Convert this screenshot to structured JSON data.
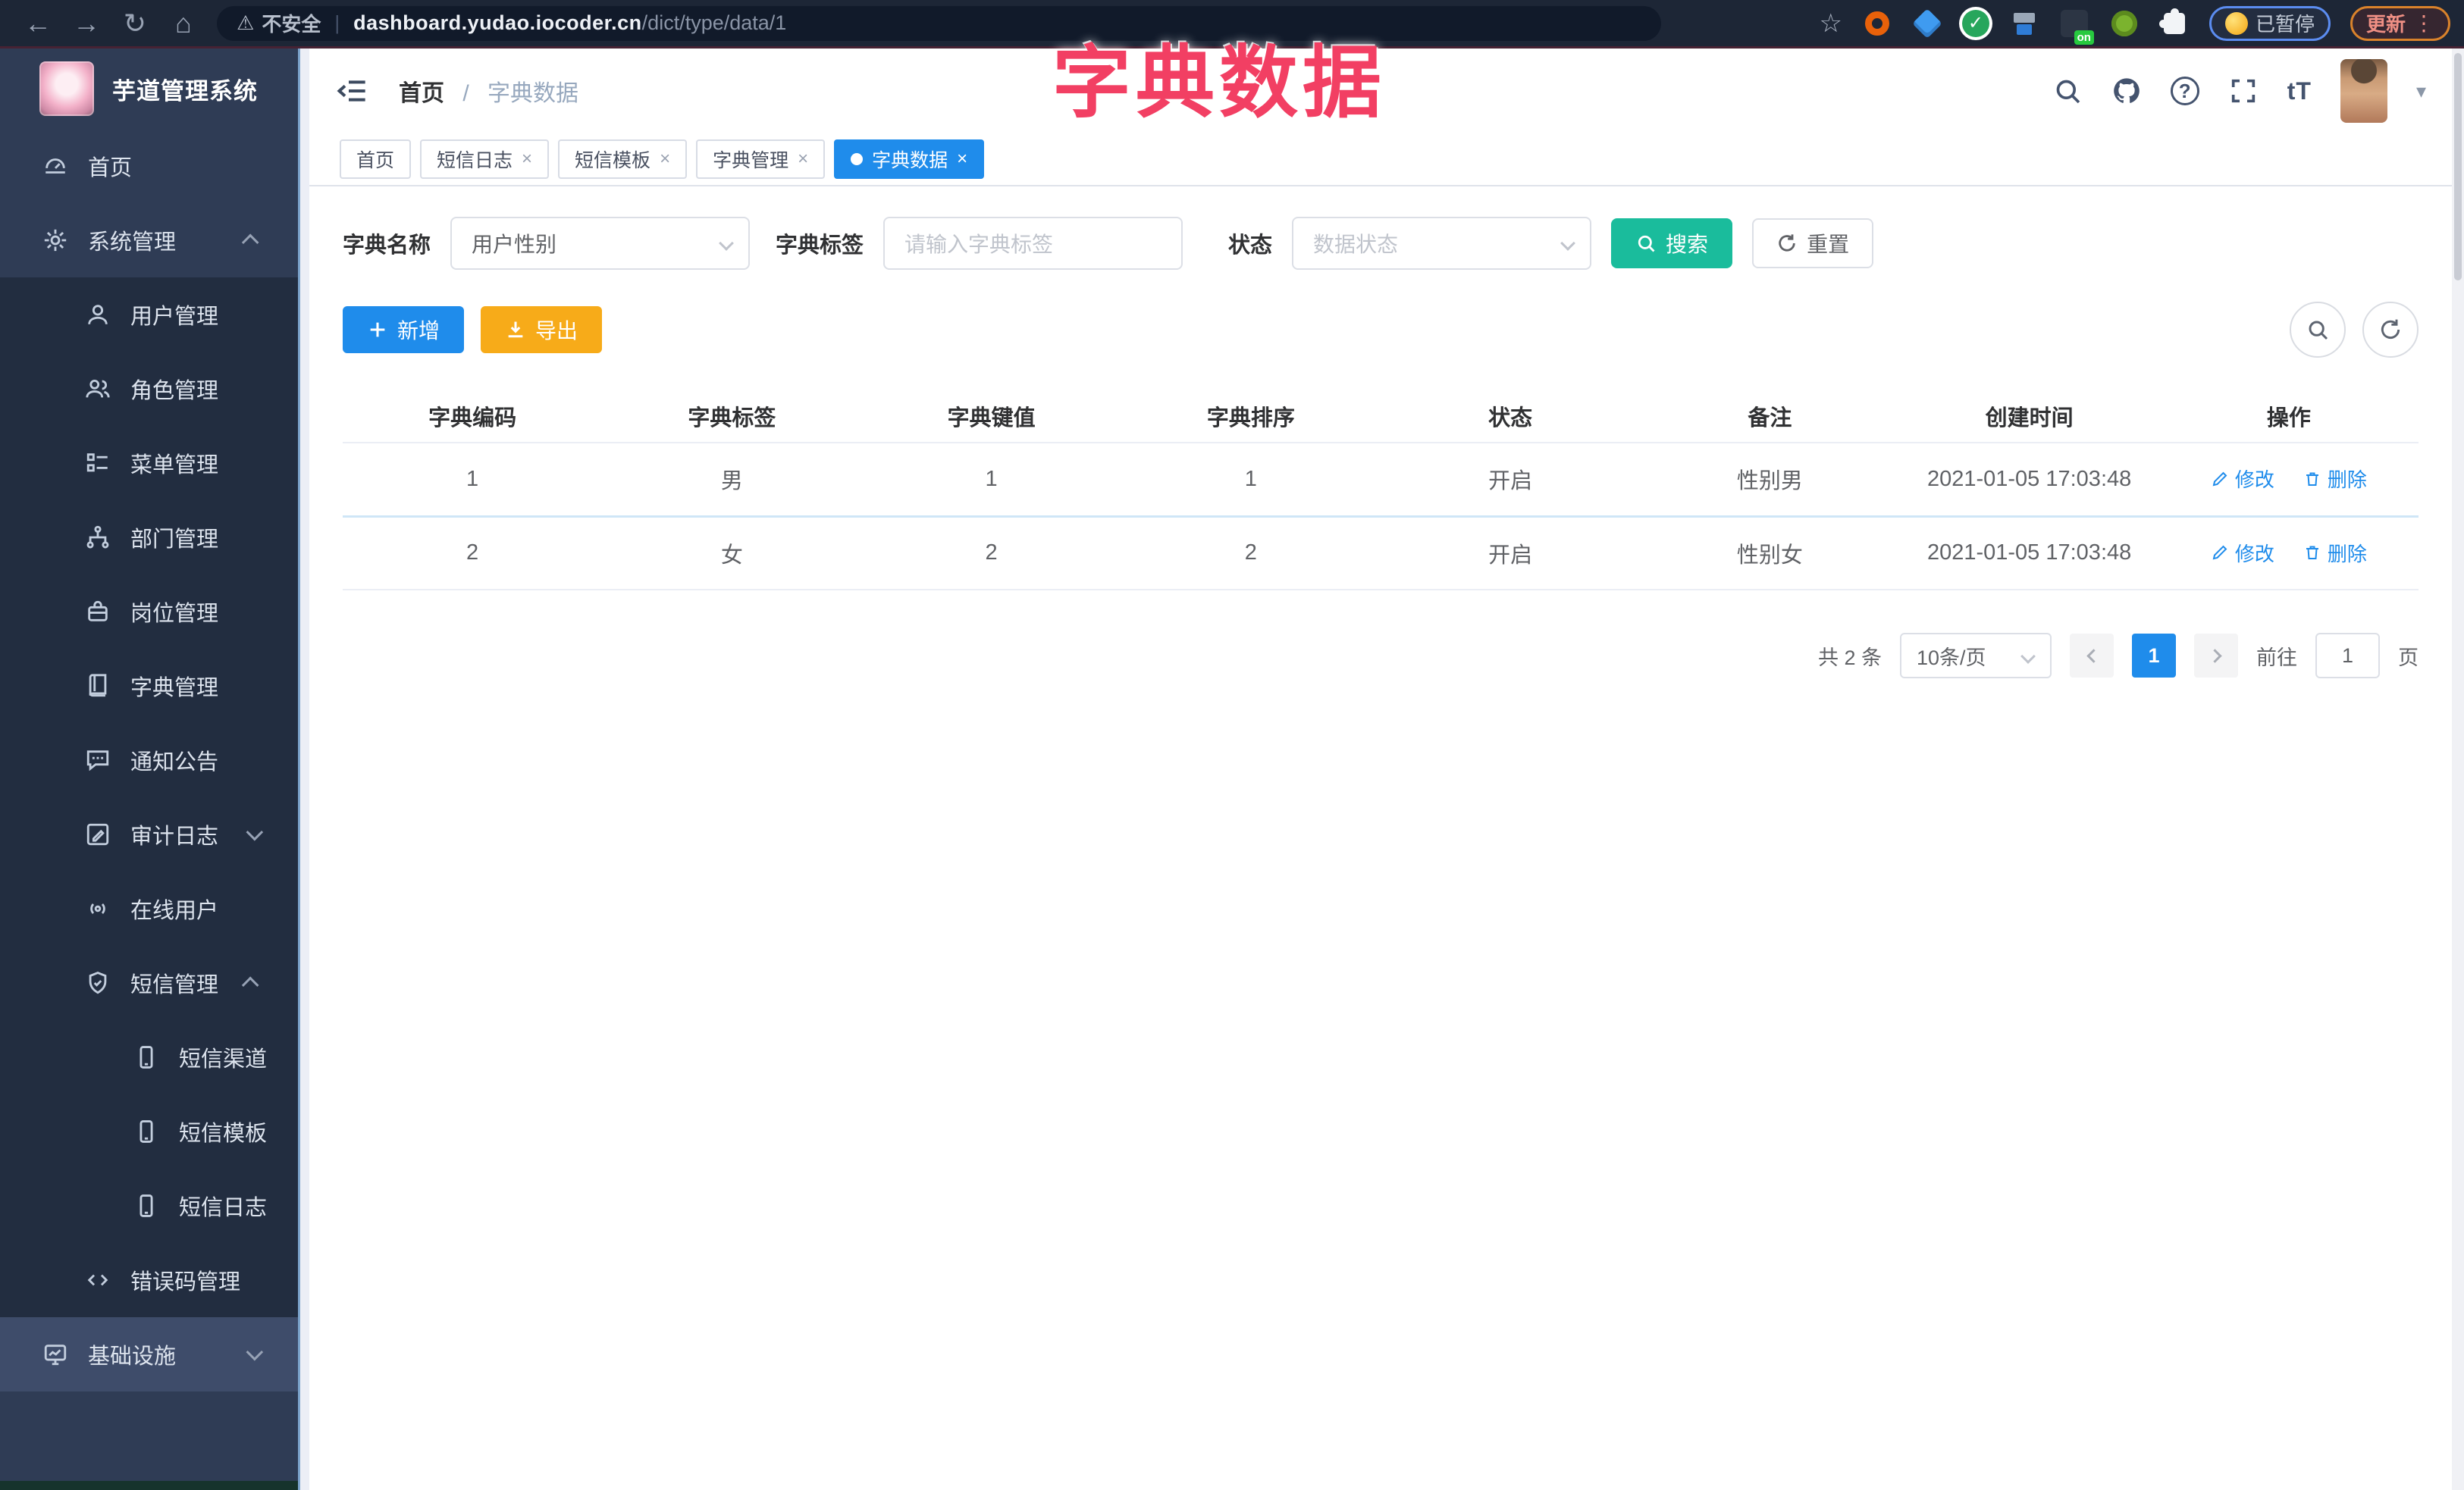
{
  "browser": {
    "security_label": "不安全",
    "url_host": "dashboard.yudao.iocoder.cn",
    "url_path": "/dict/type/data/1",
    "paused_badge": "已暂停",
    "update_button": "更新"
  },
  "icons": {
    "back": "←",
    "forward": "→",
    "reload": "↻",
    "home": "⌂",
    "warning": "⚠",
    "star": "☆",
    "divider": "|",
    "ellipsis": "⋮",
    "caret_down": "▾",
    "close": "×",
    "question": "?",
    "font_size": "tT",
    "check": "✓"
  },
  "overlay_title": "字典数据",
  "sidebar": {
    "app_title": "芋道管理系统",
    "items": [
      {
        "label": "首页"
      },
      {
        "label": "系统管理"
      },
      {
        "label": "用户管理"
      },
      {
        "label": "角色管理"
      },
      {
        "label": "菜单管理"
      },
      {
        "label": "部门管理"
      },
      {
        "label": "岗位管理"
      },
      {
        "label": "字典管理"
      },
      {
        "label": "通知公告"
      },
      {
        "label": "审计日志"
      },
      {
        "label": "在线用户"
      },
      {
        "label": "短信管理"
      },
      {
        "label": "短信渠道"
      },
      {
        "label": "短信模板"
      },
      {
        "label": "短信日志"
      },
      {
        "label": "错误码管理"
      },
      {
        "label": "基础设施"
      }
    ]
  },
  "header": {
    "breadcrumb_home": "首页",
    "breadcrumb_sep": "/",
    "breadcrumb_current": "字典数据"
  },
  "tabs": [
    {
      "label": "首页"
    },
    {
      "label": "短信日志"
    },
    {
      "label": "短信模板"
    },
    {
      "label": "字典管理"
    },
    {
      "label": "字典数据"
    }
  ],
  "filters": {
    "dict_name_label": "字典名称",
    "dict_name_value": "用户性别",
    "dict_label_label": "字典标签",
    "dict_label_placeholder": "请输入字典标签",
    "status_label": "状态",
    "status_placeholder": "数据状态",
    "search_label": "搜索",
    "reset_label": "重置"
  },
  "toolbar": {
    "add_label": "新增",
    "export_label": "导出"
  },
  "table": {
    "headers": [
      "字典编码",
      "字典标签",
      "字典键值",
      "字典排序",
      "状态",
      "备注",
      "创建时间",
      "操作"
    ],
    "rows": [
      {
        "code": "1",
        "label": "男",
        "value": "1",
        "sort": "1",
        "status": "开启",
        "remark": "性别男",
        "created": "2021-01-05 17:03:48"
      },
      {
        "code": "2",
        "label": "女",
        "value": "2",
        "sort": "2",
        "status": "开启",
        "remark": "性别女",
        "created": "2021-01-05 17:03:48"
      }
    ],
    "action_edit": "修改",
    "action_delete": "删除"
  },
  "pagination": {
    "total_text": "共 2 条",
    "page_size": "10条/页",
    "current_page": "1",
    "goto_label": "前往",
    "goto_value": "1",
    "page_unit": "页"
  },
  "colors": {
    "primary": "#1f8ceb",
    "search_teal": "#1abc9c",
    "export_orange": "#f7ab19",
    "annotation_pink": "#f23f63",
    "sidebar_bg": "#2f3c55",
    "submenu_bg": "#222d40"
  }
}
